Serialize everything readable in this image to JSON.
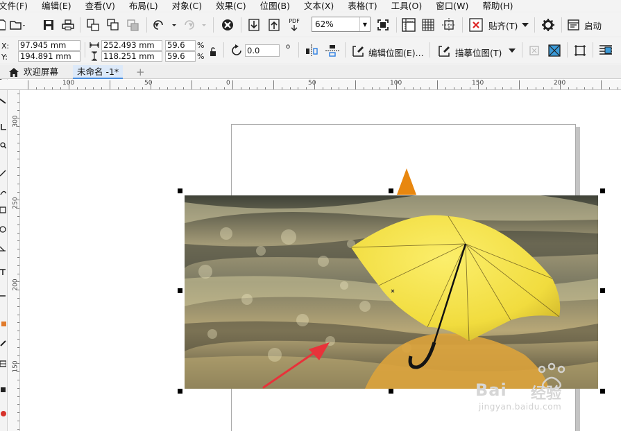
{
  "menu": [
    "文件(F)",
    "编辑(E)",
    "查看(V)",
    "布局(L)",
    "对象(C)",
    "效果(C)",
    "位图(B)",
    "文本(X)",
    "表格(T)",
    "工具(O)",
    "窗口(W)",
    "帮助(H)"
  ],
  "toolbar": {
    "zoom_value": "62%",
    "snap_label": "贴齐(T)",
    "launch_label": "启动",
    "pdf_label": "PDF"
  },
  "properties": {
    "x_label": "X:",
    "x_value": "97.945 mm",
    "y_label": "Y:",
    "y_value": "194.891 mm",
    "width_value": "252.493 mm",
    "height_value": "118.251 mm",
    "scale_w": "59.6",
    "scale_h": "59.6",
    "percent_symbol": "%",
    "rotation_value": "0.0",
    "degree_symbol": "o",
    "edit_bitmap_label": "编辑位图(E)...",
    "trace_bitmap_label": "描摹位图(T)"
  },
  "tabs": {
    "welcome": "欢迎屏幕",
    "document": "未命名 -1*",
    "add": "+"
  },
  "ruler_top_labels": [
    "100",
    "50",
    "0",
    "50",
    "100",
    "150",
    "200"
  ],
  "ruler_left_labels": [
    "300",
    "250",
    "200",
    "150"
  ],
  "watermark": {
    "brand": "Bai",
    "brand_cn": "经验",
    "url": "jingyan.baidu.com"
  },
  "colors": {
    "umbrella": "#f5e24a",
    "triangle": "#e8870f",
    "arrow": "#e8323a",
    "active_tab": "#dce9f9"
  },
  "icons": [
    "new-file-icon",
    "open-folder-icon",
    "save-icon",
    "print-icon",
    "import-icon",
    "export-icon",
    "publish-pdf-icon",
    "undo-icon",
    "redo-icon",
    "corel-connect-icon",
    "full-screen-icon",
    "show-rulers-icon",
    "show-grid-icon",
    "show-guidelines-icon",
    "snap-off-icon",
    "settings-gear-icon",
    "launcher-icon",
    "lock-ratio-icon",
    "rotate-icon",
    "mirror-horizontal-icon",
    "mirror-vertical-icon",
    "edit-bitmap-icon",
    "trace-bitmap-icon",
    "crop-bitmap-icon",
    "resample-icon",
    "bitmap-transparency-icon",
    "bounding-box-icon",
    "wrap-text-icon",
    "home-icon"
  ]
}
